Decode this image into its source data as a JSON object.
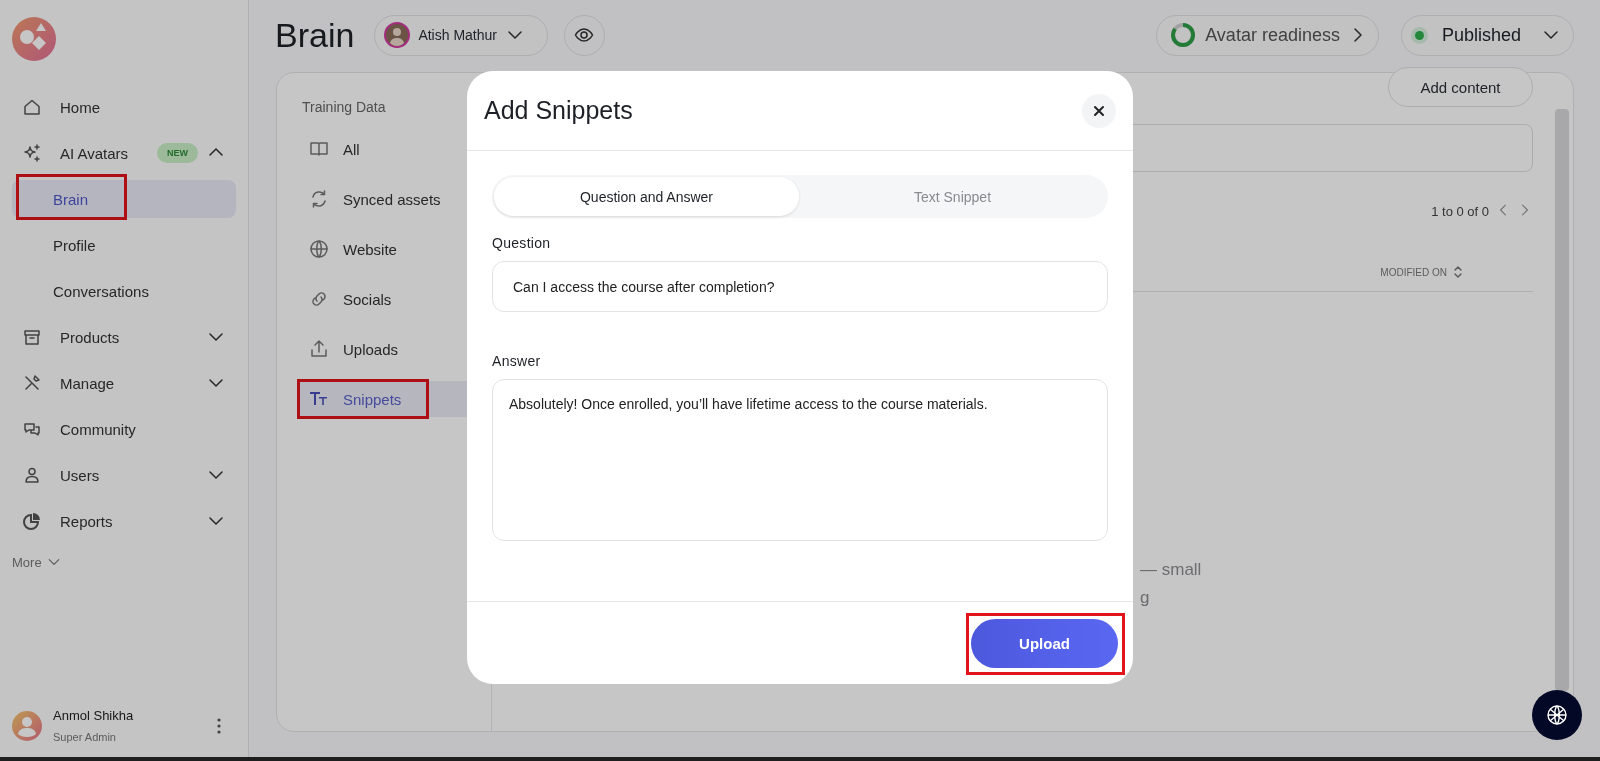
{
  "sidebar": {
    "nav": [
      {
        "label": "Home",
        "kind": "link"
      },
      {
        "label": "AI Avatars",
        "kind": "group",
        "badge": "NEW",
        "expanded": true,
        "children": [
          {
            "label": "Brain",
            "selected": true,
            "highlighted": true
          },
          {
            "label": "Profile",
            "selected": false,
            "highlighted": false
          },
          {
            "label": "Conversations",
            "selected": false,
            "highlighted": false
          }
        ]
      },
      {
        "label": "Products",
        "kind": "group",
        "expanded": false
      },
      {
        "label": "Manage",
        "kind": "group",
        "expanded": false
      },
      {
        "label": "Community",
        "kind": "link"
      },
      {
        "label": "Users",
        "kind": "group",
        "expanded": false
      },
      {
        "label": "Reports",
        "kind": "group",
        "expanded": false
      }
    ],
    "more": "More",
    "user": {
      "name": "Anmol Shikha",
      "role": "Super Admin"
    }
  },
  "header": {
    "title": "Brain",
    "person": "Atish Mathur",
    "readiness": {
      "label": "Avatar readiness",
      "level": 0.85
    },
    "status": {
      "label": "Published",
      "kind": "published"
    }
  },
  "training": {
    "heading": "Training Data",
    "items": [
      {
        "label": "All",
        "selected": false,
        "highlighted": false
      },
      {
        "label": "Synced assets",
        "selected": false,
        "highlighted": false
      },
      {
        "label": "Website",
        "selected": false,
        "highlighted": false
      },
      {
        "label": "Socials",
        "selected": false,
        "highlighted": false
      },
      {
        "label": "Uploads",
        "selected": false,
        "highlighted": false
      },
      {
        "label": "Snippets",
        "selected": true,
        "highlighted": true
      }
    ]
  },
  "content": {
    "add_button": "Add content",
    "pagination": "1 to 0 of 0",
    "columns": [
      "MODIFIED ON"
    ],
    "empty_state_fragments": [
      "— small",
      "g"
    ]
  },
  "modal": {
    "title": "Add Snippets",
    "tabs": [
      {
        "label": "Question and Answer",
        "selected": true
      },
      {
        "label": "Text Snippet",
        "selected": false
      }
    ],
    "fields": [
      {
        "label": "Question",
        "kind": "input",
        "value": "Can I access the course after completion?"
      },
      {
        "label": "Answer",
        "kind": "textarea",
        "value": "Absolutely! Once enrolled, you’ll have lifetime access to the course materials."
      }
    ],
    "submit": {
      "label": "Upload",
      "highlighted": true
    }
  }
}
